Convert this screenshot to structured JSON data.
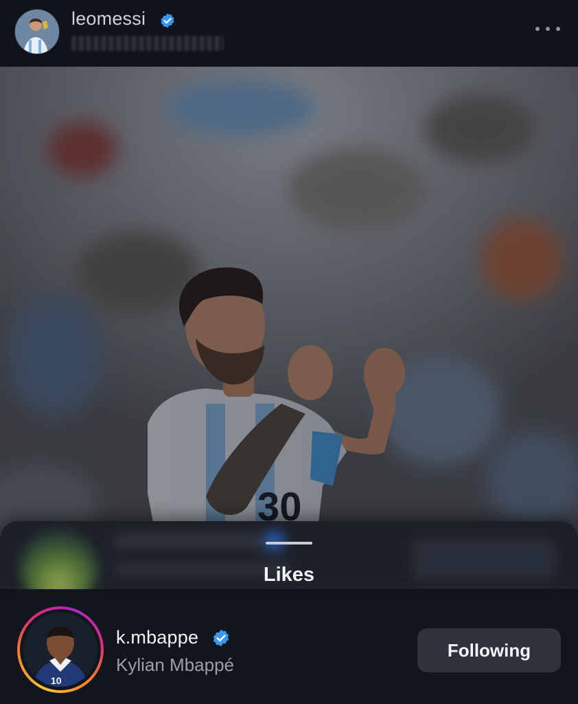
{
  "post": {
    "username": "leomessi",
    "more_icon": "more-horizontal-icon",
    "verified_icon": "verified-badge-icon"
  },
  "likes_sheet": {
    "title": "Likes",
    "liker": {
      "username": "k.mbappe",
      "full_name": "Kylian Mbappé",
      "follow_label": "Following",
      "verified_icon": "verified-badge-icon"
    }
  },
  "colors": {
    "verified_blue": "#3897f0",
    "sheet_background": "#1c2028",
    "button_background": "#2d323c"
  }
}
